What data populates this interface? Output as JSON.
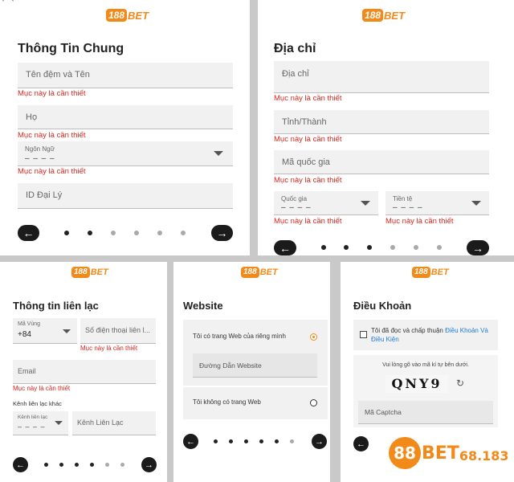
{
  "brand": {
    "logo_badge": "188",
    "logo_word": "BET",
    "accent_color": "#f28a1a",
    "error_color": "#d7261e"
  },
  "panel1": {
    "title": "Thông Tin Chung",
    "fields": {
      "middle_first_name": "Tên đệm và Tên",
      "last_name": "Họ",
      "language_label": "Ngôn Ngữ",
      "language_value": "– – – –",
      "agent_id": "ID Đại Lý"
    },
    "errors": {
      "e1": "Mục này là cần thiết",
      "e2": "Mục này là cần thiết",
      "e3": "Mục này là cần thiết"
    },
    "nav": {
      "prev": "←",
      "next": "→"
    }
  },
  "panel2": {
    "title": "Địa chỉ",
    "fields": {
      "address": "Địa chỉ",
      "province": "Tỉnh/Thành",
      "postal_code": "Mã quốc gia",
      "country_label": "Quốc gia",
      "country_value": "– – – –",
      "currency_label": "Tiền tệ",
      "currency_value": "– – – –"
    },
    "errors": {
      "e1": "Mục này là cần thiết",
      "e2": "Mục này là cần thiết",
      "e3": "Mục này là cần thiết",
      "e4": "Mục này là cần thiết",
      "e5": "Mục này là cần thiết"
    },
    "nav": {
      "prev": "←",
      "next": "→"
    }
  },
  "panel3": {
    "title": "Thông tin liên lạc",
    "fields": {
      "dial_code_label": "Mã Vùng",
      "dial_code_value": "+84",
      "phone": "Số điện thoại liên l...",
      "email": "Email",
      "other_channel_heading": "Kênh liên lạc khác",
      "channel_label": "Kênh liên lạc",
      "channel_value": "– – – –",
      "contact_channel": "Kênh Liên Lạc"
    },
    "errors": {
      "e1": "Mục này là cần thiết",
      "e2": "Mục này là cần thiết"
    },
    "nav": {
      "prev": "←",
      "next": "→"
    }
  },
  "panel4": {
    "title": "Website",
    "option_own": "Tôi có trang Web của riêng mình",
    "website_url": "Đường Dẫn Website",
    "option_none": "Tôi không có trang Web",
    "nav": {
      "prev": "←",
      "next": "→"
    }
  },
  "panel5": {
    "title": "Điều Khoản",
    "terms_prefix": "Tôi đã đọc và chấp thuận ",
    "terms_link": "Điều Khoản Và Điều Kiện",
    "captcha_instruction": "Vui lòng gõ vào mã kí tự bên dưới.",
    "captcha_code": "QNY9",
    "refresh_icon": "↻",
    "captcha_field": "Mã Captcha",
    "nav": {
      "prev": "←"
    }
  },
  "watermark": {
    "badge": "88",
    "word": "BET",
    "number": "68.183"
  }
}
